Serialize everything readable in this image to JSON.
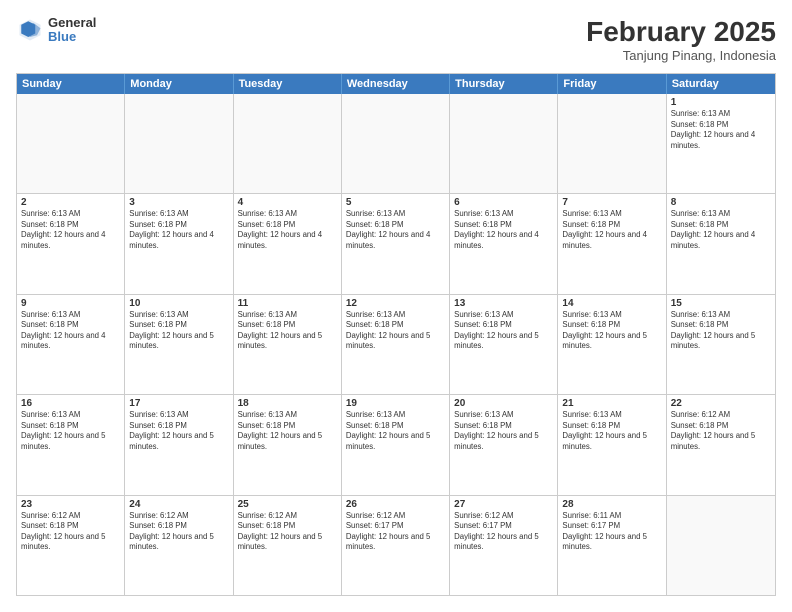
{
  "header": {
    "logo": {
      "general": "General",
      "blue": "Blue"
    },
    "title": "February 2025",
    "location": "Tanjung Pinang, Indonesia"
  },
  "calendar": {
    "days_of_week": [
      "Sunday",
      "Monday",
      "Tuesday",
      "Wednesday",
      "Thursday",
      "Friday",
      "Saturday"
    ],
    "weeks": [
      [
        {
          "day": "",
          "info": ""
        },
        {
          "day": "",
          "info": ""
        },
        {
          "day": "",
          "info": ""
        },
        {
          "day": "",
          "info": ""
        },
        {
          "day": "",
          "info": ""
        },
        {
          "day": "",
          "info": ""
        },
        {
          "day": "1",
          "info": "Sunrise: 6:13 AM\nSunset: 6:18 PM\nDaylight: 12 hours and 4 minutes."
        }
      ],
      [
        {
          "day": "2",
          "info": "Sunrise: 6:13 AM\nSunset: 6:18 PM\nDaylight: 12 hours and 4 minutes."
        },
        {
          "day": "3",
          "info": "Sunrise: 6:13 AM\nSunset: 6:18 PM\nDaylight: 12 hours and 4 minutes."
        },
        {
          "day": "4",
          "info": "Sunrise: 6:13 AM\nSunset: 6:18 PM\nDaylight: 12 hours and 4 minutes."
        },
        {
          "day": "5",
          "info": "Sunrise: 6:13 AM\nSunset: 6:18 PM\nDaylight: 12 hours and 4 minutes."
        },
        {
          "day": "6",
          "info": "Sunrise: 6:13 AM\nSunset: 6:18 PM\nDaylight: 12 hours and 4 minutes."
        },
        {
          "day": "7",
          "info": "Sunrise: 6:13 AM\nSunset: 6:18 PM\nDaylight: 12 hours and 4 minutes."
        },
        {
          "day": "8",
          "info": "Sunrise: 6:13 AM\nSunset: 6:18 PM\nDaylight: 12 hours and 4 minutes."
        }
      ],
      [
        {
          "day": "9",
          "info": "Sunrise: 6:13 AM\nSunset: 6:18 PM\nDaylight: 12 hours and 4 minutes."
        },
        {
          "day": "10",
          "info": "Sunrise: 6:13 AM\nSunset: 6:18 PM\nDaylight: 12 hours and 5 minutes."
        },
        {
          "day": "11",
          "info": "Sunrise: 6:13 AM\nSunset: 6:18 PM\nDaylight: 12 hours and 5 minutes."
        },
        {
          "day": "12",
          "info": "Sunrise: 6:13 AM\nSunset: 6:18 PM\nDaylight: 12 hours and 5 minutes."
        },
        {
          "day": "13",
          "info": "Sunrise: 6:13 AM\nSunset: 6:18 PM\nDaylight: 12 hours and 5 minutes."
        },
        {
          "day": "14",
          "info": "Sunrise: 6:13 AM\nSunset: 6:18 PM\nDaylight: 12 hours and 5 minutes."
        },
        {
          "day": "15",
          "info": "Sunrise: 6:13 AM\nSunset: 6:18 PM\nDaylight: 12 hours and 5 minutes."
        }
      ],
      [
        {
          "day": "16",
          "info": "Sunrise: 6:13 AM\nSunset: 6:18 PM\nDaylight: 12 hours and 5 minutes."
        },
        {
          "day": "17",
          "info": "Sunrise: 6:13 AM\nSunset: 6:18 PM\nDaylight: 12 hours and 5 minutes."
        },
        {
          "day": "18",
          "info": "Sunrise: 6:13 AM\nSunset: 6:18 PM\nDaylight: 12 hours and 5 minutes."
        },
        {
          "day": "19",
          "info": "Sunrise: 6:13 AM\nSunset: 6:18 PM\nDaylight: 12 hours and 5 minutes."
        },
        {
          "day": "20",
          "info": "Sunrise: 6:13 AM\nSunset: 6:18 PM\nDaylight: 12 hours and 5 minutes."
        },
        {
          "day": "21",
          "info": "Sunrise: 6:13 AM\nSunset: 6:18 PM\nDaylight: 12 hours and 5 minutes."
        },
        {
          "day": "22",
          "info": "Sunrise: 6:12 AM\nSunset: 6:18 PM\nDaylight: 12 hours and 5 minutes."
        }
      ],
      [
        {
          "day": "23",
          "info": "Sunrise: 6:12 AM\nSunset: 6:18 PM\nDaylight: 12 hours and 5 minutes."
        },
        {
          "day": "24",
          "info": "Sunrise: 6:12 AM\nSunset: 6:18 PM\nDaylight: 12 hours and 5 minutes."
        },
        {
          "day": "25",
          "info": "Sunrise: 6:12 AM\nSunset: 6:18 PM\nDaylight: 12 hours and 5 minutes."
        },
        {
          "day": "26",
          "info": "Sunrise: 6:12 AM\nSunset: 6:17 PM\nDaylight: 12 hours and 5 minutes."
        },
        {
          "day": "27",
          "info": "Sunrise: 6:12 AM\nSunset: 6:17 PM\nDaylight: 12 hours and 5 minutes."
        },
        {
          "day": "28",
          "info": "Sunrise: 6:11 AM\nSunset: 6:17 PM\nDaylight: 12 hours and 5 minutes."
        },
        {
          "day": "",
          "info": ""
        }
      ]
    ]
  }
}
